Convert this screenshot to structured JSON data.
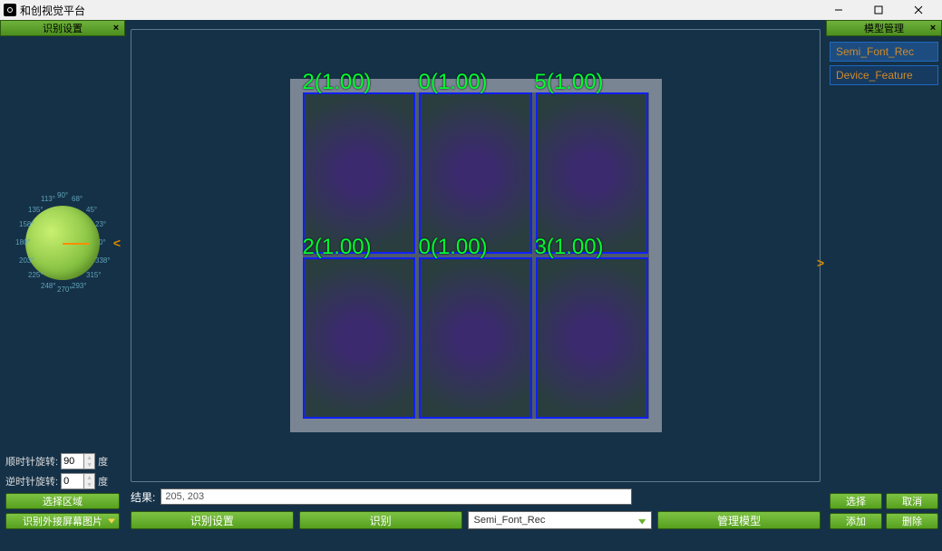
{
  "window": {
    "title": "和创视觉平台",
    "min": "minimize",
    "max": "maximize",
    "close": "close"
  },
  "left_panel": {
    "header": "识别设置",
    "compass_labels": [
      "0°",
      "23°",
      "45°",
      "68°",
      "90°",
      "113°",
      "135°",
      "158°",
      "180°",
      "203°",
      "225°",
      "248°",
      "270°",
      "293°",
      "315°",
      "338°"
    ],
    "cw_label": "顺时针旋转:",
    "cw_value": "90",
    "ccw_label": "逆时针旋转:",
    "ccw_value": "0",
    "deg_unit": "度",
    "select_area_btn": "选择区域",
    "external_img_btn": "识别外接屏幕图片"
  },
  "center": {
    "detections": [
      {
        "text": "2(1.00)"
      },
      {
        "text": "0(1.00)"
      },
      {
        "text": "5(1.00)"
      },
      {
        "text": "2(1.00)"
      },
      {
        "text": "0(1.00)"
      },
      {
        "text": "3(1.00)"
      }
    ],
    "result_label": "结果:",
    "result_value": "205, 203",
    "bottom_buttons": {
      "rec_settings": "识别设置",
      "recognize": "识别",
      "model_select": "Semi_Font_Rec",
      "manage_models": "管理模型"
    }
  },
  "right_panel": {
    "header": "模型管理",
    "models": [
      {
        "name": "Semi_Font_Rec",
        "selected": true
      },
      {
        "name": "Device_Feature",
        "selected": false
      }
    ],
    "select_btn": "选择",
    "cancel_btn": "取消",
    "add_btn": "添加",
    "delete_btn": "删除"
  }
}
